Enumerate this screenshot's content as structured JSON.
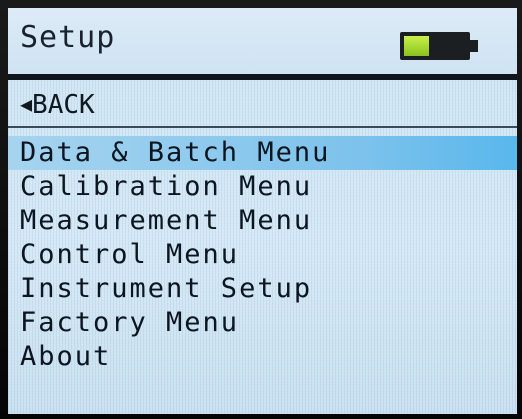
{
  "header": {
    "title": "Setup",
    "battery": {
      "level_fraction": 0.4,
      "fill_color": "#a4dc2c",
      "icon": "battery-icon"
    }
  },
  "back": {
    "arrow_icon": "triangle-left-icon",
    "arrow_glyph": "◀",
    "label": "BACK"
  },
  "menu": {
    "selected_index": 0,
    "highlight_color": "#6cc3f0",
    "items": [
      {
        "label": "Data & Batch Menu"
      },
      {
        "label": "Calibration Menu"
      },
      {
        "label": "Measurement Menu"
      },
      {
        "label": "Control Menu"
      },
      {
        "label": "Instrument Setup"
      },
      {
        "label": "Factory Menu"
      },
      {
        "label": "About"
      }
    ]
  }
}
